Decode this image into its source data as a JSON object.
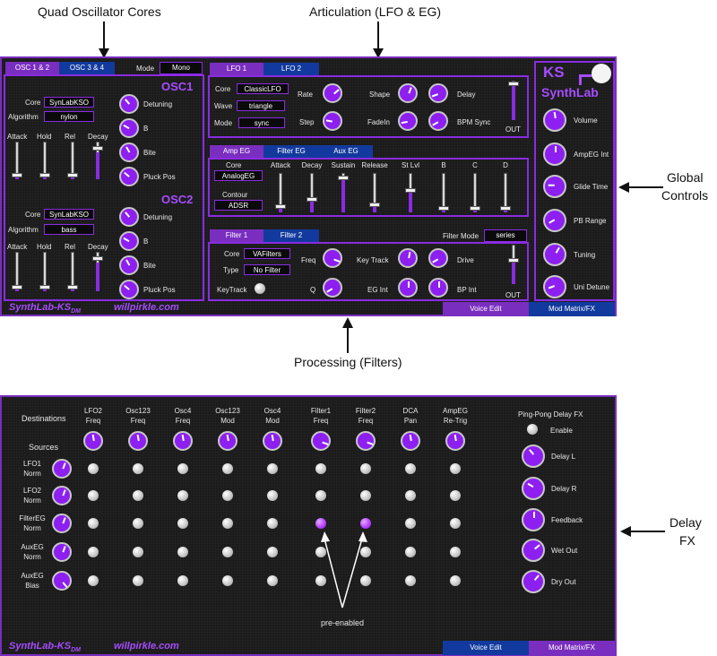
{
  "annotations": {
    "quad_osc": "Quad Oscillator Cores",
    "articulation": "Articulation (LFO & EG)",
    "global_controls_1": "Global",
    "global_controls_2": "Controls",
    "processing": "Processing (Filters)",
    "delay_fx_1": "Delay",
    "delay_fx_2": "FX",
    "pre_enabled": "pre-enabled"
  },
  "panel1": {
    "osc_tabs": [
      "OSC 1 & 2",
      "OSC 3 & 4"
    ],
    "mode_label": "Mode",
    "mode_value": "Mono",
    "osc1": {
      "header": "OSC1",
      "core_label": "Core",
      "core_value": "SynLabKSO",
      "algorithm_label": "Algorithm",
      "algorithm_value": "nylon",
      "knobs": [
        "Detuning",
        "B",
        "Bite",
        "Pluck Pos"
      ],
      "sliders": [
        "Attack",
        "Hold",
        "Rel",
        "Decay"
      ]
    },
    "osc2": {
      "header": "OSC2",
      "core_label": "Core",
      "core_value": "SynLabKSO",
      "algorithm_label": "Algorithm",
      "algorithm_value": "bass",
      "knobs": [
        "Detuning",
        "B",
        "Bite",
        "Pluck Pos"
      ],
      "sliders": [
        "Attack",
        "Hold",
        "Rel",
        "Decay"
      ]
    },
    "lfo": {
      "tabs": [
        "LFO 1",
        "LFO 2"
      ],
      "core_label": "Core",
      "core_value": "ClassicLFO",
      "wave_label": "Wave",
      "wave_value": "triangle",
      "mode_label": "Mode",
      "mode_value": "sync",
      "rate": "Rate",
      "step": "Step",
      "shape": "Shape",
      "fadein": "FadeIn",
      "delay": "Delay",
      "bpm_sync": "BPM Sync",
      "out": "OUT"
    },
    "eg": {
      "tabs": [
        "Amp EG",
        "Filter EG",
        "Aux EG"
      ],
      "core_label": "Core",
      "core_value": "AnalogEG",
      "contour_label": "Contour",
      "contour_value": "ADSR",
      "sliders": [
        "Attack",
        "Decay",
        "Sustain",
        "Release",
        "St Lvl",
        "B",
        "C",
        "D"
      ]
    },
    "filter": {
      "tabs": [
        "Filter 1",
        "Filter 2"
      ],
      "filter_mode_label": "Filter Mode",
      "filter_mode_value": "series",
      "core_label": "Core",
      "core_value": "VAFilters",
      "type_label": "Type",
      "type_value": "No Filter",
      "keytrack_label": "KeyTrack",
      "freq": "Freq",
      "q": "Q",
      "key_track": "Key Track",
      "eg_int": "EG Int",
      "drive": "Drive",
      "bp_int": "BP Int",
      "out": "OUT"
    },
    "global": {
      "logo_ks": "KS",
      "logo_synthlab": "SynthLab",
      "knobs": [
        "Volume",
        "AmpEG Int",
        "Glide Time",
        "PB Range",
        "Tuning",
        "Uni Detune"
      ]
    },
    "footer": {
      "brand": "SynthLab-KS",
      "brand_sub": "DM",
      "site": "willpirkle.com",
      "voice_edit": "Voice Edit",
      "mod_matrix": "Mod Matrix/FX"
    }
  },
  "panel2": {
    "destinations_label": "Destinations",
    "sources_label": "Sources",
    "destinations": [
      [
        "LFO2",
        "Freq"
      ],
      [
        "Osc123",
        "Freq"
      ],
      [
        "Osc4",
        "Freq"
      ],
      [
        "Osc123",
        "Mod"
      ],
      [
        "Osc4",
        "Mod"
      ],
      [
        "Filter1",
        "Freq"
      ],
      [
        "Filter2",
        "Freq"
      ],
      [
        "DCA",
        "Pan"
      ],
      [
        "AmpEG",
        "Re-Trig"
      ]
    ],
    "sources": [
      [
        "LFO1",
        "Norm"
      ],
      [
        "LFO2",
        "Norm"
      ],
      [
        "FilterEG",
        "Norm"
      ],
      [
        "AuxEG",
        "Norm"
      ],
      [
        "AuxEG",
        "Bias"
      ]
    ],
    "enabled": [
      [
        2,
        5
      ],
      [
        2,
        6
      ]
    ],
    "delay": {
      "title": "Ping-Pong Delay FX",
      "enable": "Enable",
      "knobs": [
        "Delay L",
        "Delay R",
        "Feedback",
        "Wet Out",
        "Dry Out"
      ]
    },
    "footer": {
      "brand": "SynthLab-KS",
      "brand_sub": "DM",
      "site": "willpirkle.com",
      "voice_edit": "Voice Edit",
      "mod_matrix": "Mod Matrix/FX"
    }
  }
}
